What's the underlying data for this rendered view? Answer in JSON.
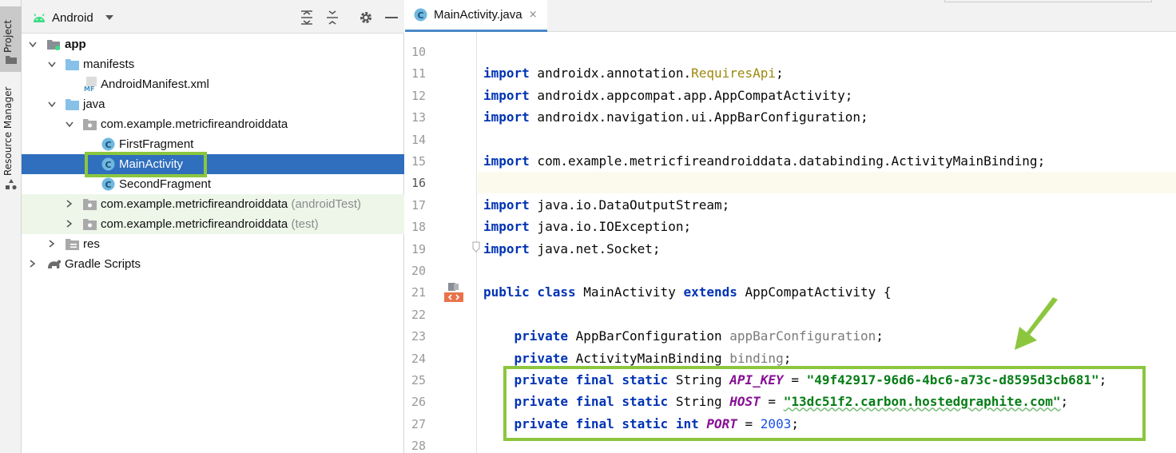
{
  "sidebar_strip": {
    "project_label": "Project",
    "resource_manager_label": "Resource Manager"
  },
  "project_panel": {
    "view_selector": "Android",
    "toolbar_icons": [
      "expand-all-icon",
      "collapse-all-icon",
      "gear-icon",
      "minimize-icon"
    ],
    "tree": [
      {
        "label": "app",
        "icon": "module-folder-icon",
        "expanded": true
      },
      {
        "label": "manifests",
        "icon": "folder-icon",
        "expanded": true
      },
      {
        "label": "AndroidManifest.xml",
        "icon": "manifest-file-icon"
      },
      {
        "label": "java",
        "icon": "folder-icon",
        "expanded": true
      },
      {
        "label": "com.example.metricfireandroiddata",
        "icon": "package-icon",
        "expanded": true
      },
      {
        "label": "FirstFragment",
        "icon": "class-icon"
      },
      {
        "label": "MainActivity",
        "icon": "class-icon",
        "selected": true
      },
      {
        "label": "SecondFragment",
        "icon": "class-icon"
      },
      {
        "label": "com.example.metricfireandroiddata",
        "suffix": "(androidTest)",
        "icon": "package-icon",
        "expanded": false
      },
      {
        "label": "com.example.metricfireandroiddata",
        "suffix": "(test)",
        "icon": "package-icon",
        "expanded": false
      },
      {
        "label": "res",
        "icon": "res-folder-icon",
        "expanded": false
      },
      {
        "label": "Gradle Scripts",
        "icon": "gradle-icon",
        "expanded": false
      }
    ]
  },
  "editor": {
    "tab": {
      "label": "MainActivity.java",
      "close": "×"
    },
    "current_line": 16,
    "lines": [
      {
        "n": "10",
        "text": ""
      },
      {
        "n": "11",
        "t": [
          {
            "c": "kw",
            "s": "import"
          },
          {
            "s": " androidx.annotation."
          },
          {
            "c": "ann",
            "s": "RequiresApi"
          },
          {
            "s": ";"
          }
        ]
      },
      {
        "n": "12",
        "t": [
          {
            "c": "kw",
            "s": "import"
          },
          {
            "s": " androidx.appcompat.app.AppCompatActivity;"
          }
        ]
      },
      {
        "n": "13",
        "t": [
          {
            "c": "kw",
            "s": "import"
          },
          {
            "s": " androidx.navigation.ui.AppBarConfiguration;"
          }
        ]
      },
      {
        "n": "14",
        "text": ""
      },
      {
        "n": "15",
        "t": [
          {
            "c": "kw",
            "s": "import"
          },
          {
            "s": " com.example.metricfireandroiddata.databinding.ActivityMainBinding;"
          }
        ]
      },
      {
        "n": "16",
        "text": ""
      },
      {
        "n": "17",
        "t": [
          {
            "c": "kw",
            "s": "import"
          },
          {
            "s": " java.io.DataOutputStream;"
          }
        ]
      },
      {
        "n": "18",
        "t": [
          {
            "c": "kw",
            "s": "import"
          },
          {
            "s": " java.io.IOException;"
          }
        ]
      },
      {
        "n": "19",
        "t": [
          {
            "c": "kw",
            "s": "import"
          },
          {
            "s": " java.net.Socket;"
          }
        ]
      },
      {
        "n": "20",
        "text": ""
      },
      {
        "n": "21",
        "t": [
          {
            "c": "kw",
            "s": "public class"
          },
          {
            "s": " MainActivity "
          },
          {
            "c": "kw",
            "s": "extends"
          },
          {
            "s": " AppCompatActivity {"
          }
        ]
      },
      {
        "n": "22",
        "text": ""
      },
      {
        "n": "23",
        "t": [
          {
            "s": "    "
          },
          {
            "c": "kw",
            "s": "private"
          },
          {
            "s": " AppBarConfiguration "
          },
          {
            "c": "unused",
            "s": "appBarConfiguration"
          },
          {
            "s": ";"
          }
        ]
      },
      {
        "n": "24",
        "t": [
          {
            "s": "    "
          },
          {
            "c": "kw",
            "s": "private"
          },
          {
            "s": " ActivityMainBinding "
          },
          {
            "c": "unused",
            "s": "binding"
          },
          {
            "s": ";"
          }
        ]
      },
      {
        "n": "25",
        "t": [
          {
            "s": "    "
          },
          {
            "c": "kw",
            "s": "private final static"
          },
          {
            "s": " String "
          },
          {
            "c": "const",
            "s": "API_KEY"
          },
          {
            "s": " = "
          },
          {
            "c": "str",
            "s": "\"49f42917-96d6-4bc6-a73c-d8595d3cb681\""
          },
          {
            "s": ";"
          }
        ]
      },
      {
        "n": "26",
        "t": [
          {
            "s": "    "
          },
          {
            "c": "kw",
            "s": "private final static"
          },
          {
            "s": " String "
          },
          {
            "c": "const",
            "s": "HOST"
          },
          {
            "s": " = "
          },
          {
            "c": "str",
            "s": "\"13dc51f2.carbon.hostedgraphite.com\""
          },
          {
            "s": ";"
          }
        ]
      },
      {
        "n": "27",
        "t": [
          {
            "s": "    "
          },
          {
            "c": "kw",
            "s": "private final static int"
          },
          {
            "s": " "
          },
          {
            "c": "const",
            "s": "PORT"
          },
          {
            "s": " = "
          },
          {
            "c": "num",
            "s": "2003"
          },
          {
            "s": ";"
          }
        ]
      },
      {
        "n": "28",
        "text": ""
      }
    ]
  },
  "colors": {
    "selection": "#2f6fbd",
    "highlight_border": "#8cc63f",
    "keyword": "#0033b3",
    "string": "#067d17"
  }
}
